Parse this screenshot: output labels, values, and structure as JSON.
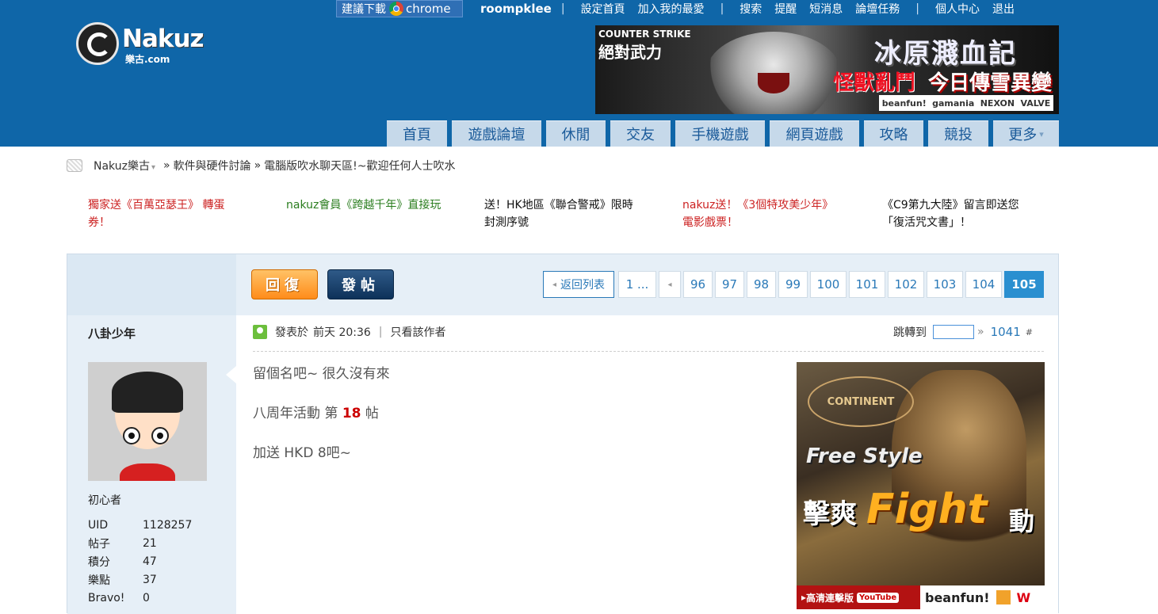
{
  "topbar": {
    "chrome_promo": "建議下載",
    "chrome_name": "chrome",
    "username": "roompklee",
    "links_a": [
      "設定首頁",
      "加入我的最愛"
    ],
    "links_b": [
      "搜索",
      "提醒",
      "短消息",
      "論壇任務"
    ],
    "links_c": [
      "個人中心",
      "退出"
    ],
    "separator": "|"
  },
  "logo": {
    "name": "Nakuz",
    "sub": "樂古.com"
  },
  "banner": {
    "cs_line1": "COUNTER STRIKE",
    "cs_line2": "絕對武力",
    "title": "冰原濺血記",
    "tag1": "怪獸亂鬥",
    "tag2": "今日傳雪異變",
    "brands": [
      "beanfun!",
      "gamania",
      "NEXON",
      "VALVE"
    ]
  },
  "nav": [
    "首頁",
    "遊戲論壇",
    "休閒",
    "交友",
    "手機遊戲",
    "網頁遊戲",
    "攻略",
    "競投",
    "更多"
  ],
  "breadcrumb": {
    "site": "Nakuz樂古",
    "sep": "»",
    "items": [
      "軟件與硬件討論",
      "電腦版吹水聊天區!~歡迎任何人士吹水"
    ]
  },
  "announcements": [
    "獨家送《百萬亞瑟王》 轉蛋券！",
    "nakuz會員《跨越千年》直接玩",
    "送！HK地區《聯合警戒》限時封測序號",
    "nakuz送！《3個特攻美少年》電影戲票！",
    "《C9第九大陸》留言即送您「復活咒文書」！"
  ],
  "colors": {
    "header_bg": "#0f66a8",
    "link_blue": "#2a79b8",
    "announce_red": "#cc2222",
    "announce_green": "#2a7d1e"
  },
  "buttons": {
    "reply": "回復",
    "post": "發帖"
  },
  "pager": {
    "back": "返回列表",
    "first": "1 ...",
    "pages": [
      "96",
      "97",
      "98",
      "99",
      "100",
      "101",
      "102",
      "103",
      "104"
    ],
    "current": "105"
  },
  "author": {
    "name": "八卦少年",
    "rank": "初心者",
    "stats": [
      {
        "k": "UID",
        "v": "1128257"
      },
      {
        "k": "帖子",
        "v": "21"
      },
      {
        "k": "積分",
        "v": "47"
      },
      {
        "k": "樂點",
        "v": "37"
      },
      {
        "k": "Bravo!",
        "v": "0"
      }
    ]
  },
  "post": {
    "posted_prefix": "發表於",
    "posted_time": "前天 20:36",
    "only_author": "只看該作者",
    "jump_label": "跳轉到",
    "jump_arrow": "»",
    "floor": "1041",
    "floor_suffix": "#",
    "line1": "留個名吧~ 很久沒有來",
    "line2_pre": "八周年活動 第",
    "line2_num": "18",
    "line2_post": "帖",
    "line3": "加送 HKD 8吧~"
  },
  "ad": {
    "logo": "CONTINENT",
    "t1": "Free Style",
    "t2": "擊爽",
    "t3": "Fight",
    "t4": "動",
    "foot": "高清連擊版",
    "yt": "YouTube",
    "bf": "beanfun!",
    "w": "W"
  }
}
